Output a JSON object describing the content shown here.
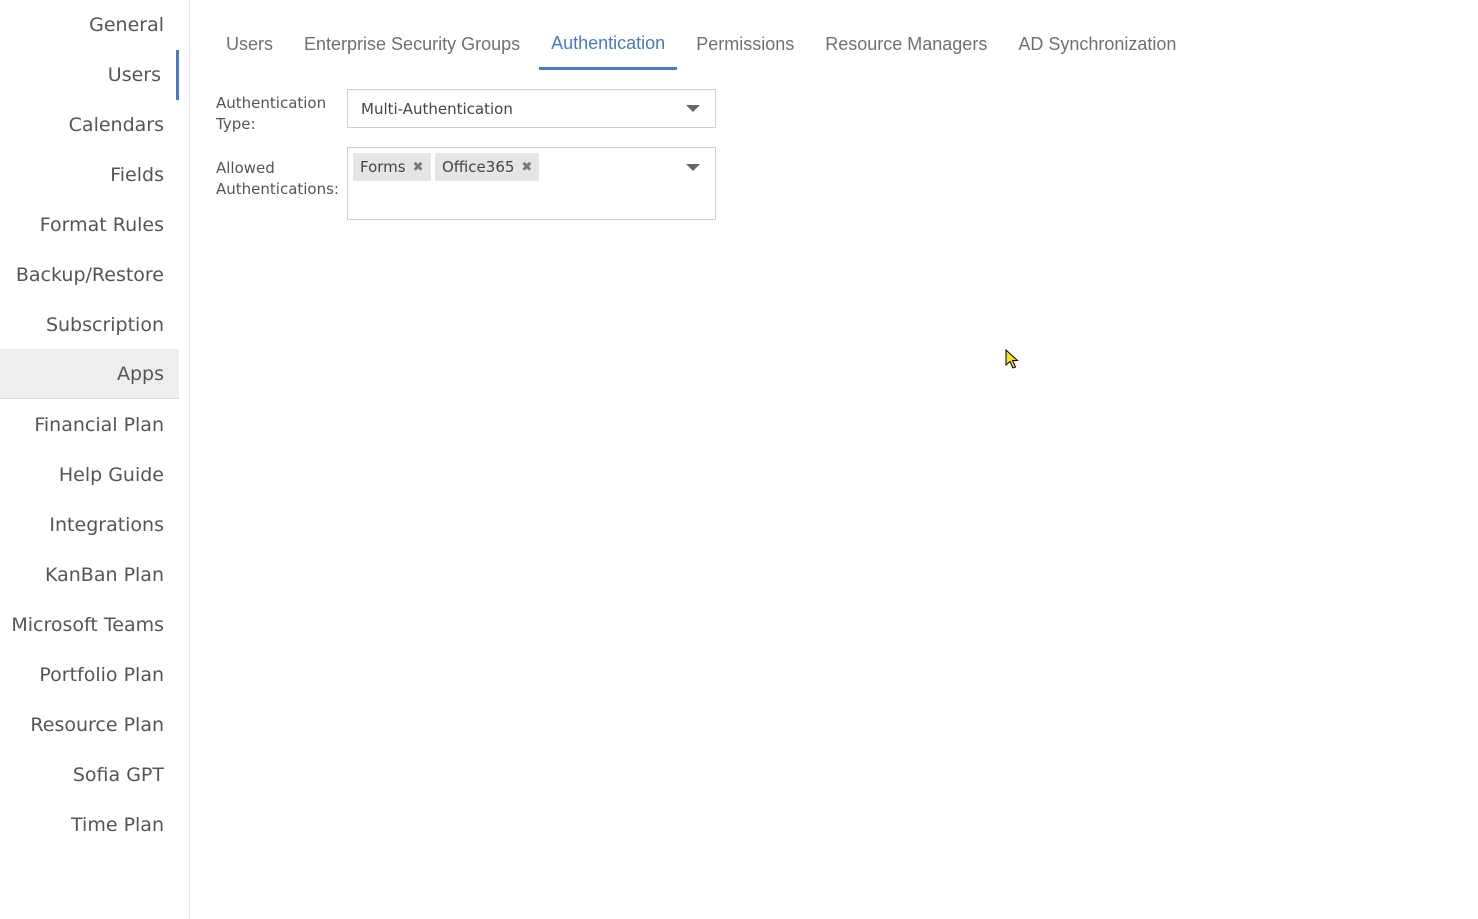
{
  "sidebar": {
    "items": [
      {
        "label": "General"
      },
      {
        "label": "Users"
      },
      {
        "label": "Calendars"
      },
      {
        "label": "Fields"
      },
      {
        "label": "Format Rules"
      },
      {
        "label": "Backup/Restore"
      },
      {
        "label": "Subscription"
      },
      {
        "label": "Apps"
      },
      {
        "label": "Financial Plan"
      },
      {
        "label": "Help Guide"
      },
      {
        "label": "Integrations"
      },
      {
        "label": "KanBan Plan"
      },
      {
        "label": "Microsoft Teams"
      },
      {
        "label": "Portfolio Plan"
      },
      {
        "label": "Resource Plan"
      },
      {
        "label": "Sofia GPT"
      },
      {
        "label": "Time Plan"
      }
    ],
    "active_item": "Users",
    "highlighted_item": "Apps"
  },
  "tabs": {
    "items": [
      {
        "label": "Users"
      },
      {
        "label": "Enterprise Security Groups"
      },
      {
        "label": "Authentication"
      },
      {
        "label": "Permissions"
      },
      {
        "label": "Resource Managers"
      },
      {
        "label": "AD Synchronization"
      }
    ],
    "active_tab": "Authentication"
  },
  "form": {
    "auth_type": {
      "label_line1": "Authentication",
      "label_line2": "Type:",
      "value": "Multi-Authentication",
      "icon": "chevron-down-icon"
    },
    "allowed_auth": {
      "label_line1": "Allowed",
      "label_line2": "Authentications:",
      "tags": [
        {
          "label": "Forms",
          "remove_icon": "✖"
        },
        {
          "label": "Office365",
          "remove_icon": "✖"
        }
      ],
      "icon": "chevron-down-icon"
    }
  },
  "colors": {
    "accent": "#4a78c2",
    "text": "#555555",
    "tag_bg": "#e5e5e5",
    "highlight_bg": "#eeeeee"
  }
}
